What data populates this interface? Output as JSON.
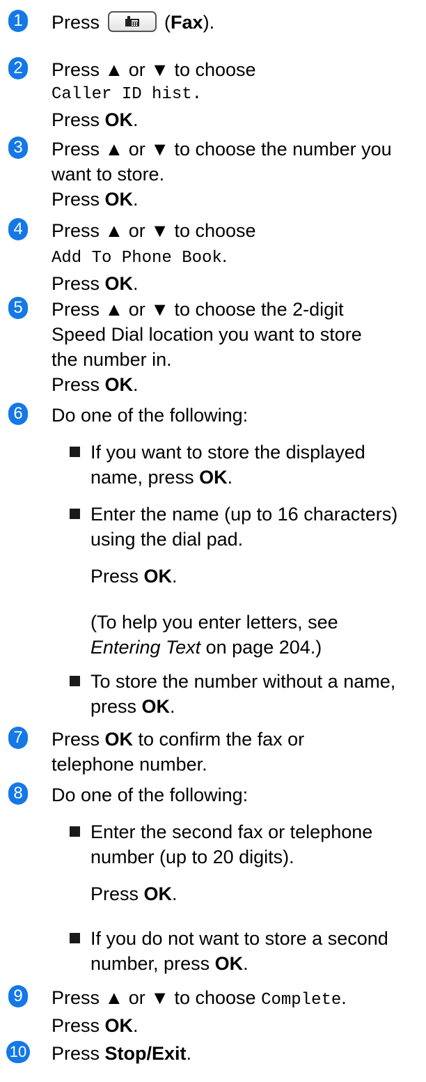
{
  "steps": [
    {
      "n": "1",
      "press": "Press",
      "fax_open": " (",
      "fax": "Fax",
      "fax_close": ")."
    },
    {
      "n": "2",
      "l1": "Press ▲ or ▼ to choose",
      "menu": "Caller ID hist.",
      "press": "Press ",
      "ok": "OK",
      "dot": "."
    },
    {
      "n": "3",
      "l1": "Press ▲ or ▼ to choose the number you",
      "l2": "want to store.",
      "press": "Press ",
      "ok": "OK",
      "dot": "."
    },
    {
      "n": "4",
      "l1": "Press ▲ or ▼ to choose",
      "menu": "Add To Phone Book",
      "menu_dot": ".",
      "press": "Press ",
      "ok": "OK",
      "dot": "."
    },
    {
      "n": "5",
      "l1": "Press ▲ or ▼ to choose the 2-digit",
      "l2": "Speed Dial location you want to store",
      "l3": "the number in.",
      "press": "Press ",
      "ok": "OK",
      "dot": "."
    },
    {
      "n": "6",
      "l1": "Do one of the following:",
      "b1_l1": "If you want to store the displayed",
      "b1_l2": "name, press ",
      "b1_ok": "OK",
      "b1_dot": ".",
      "b2_l1": "Enter the name (up to 16 characters)",
      "b2_l2": "using the dial pad.",
      "b2_press": "Press ",
      "b2_ok": "OK",
      "b2_dot": ".",
      "b2_help": "(To help you enter letters, see",
      "b2_link": "Entering Text",
      "b2_page": " on page 204.)",
      "b3_l1": "To store the number without a name,",
      "b3_l2": "press ",
      "b3_ok": "OK",
      "b3_dot": "."
    },
    {
      "n": "7",
      "press": "Press ",
      "ok": "OK",
      "l1_rest": " to confirm the fax or",
      "l2": "telephone number."
    },
    {
      "n": "8",
      "l1": "Do one of the following:",
      "b1_l1": "Enter the second fax or telephone",
      "b1_l2": "number (up to 20 digits).",
      "b1_press": "Press ",
      "b1_ok": "OK",
      "b1_dot": ".",
      "b2_l1": "If you do not want to store a second",
      "b2_l2": "number, press ",
      "b2_ok": "OK",
      "b2_dot": "."
    },
    {
      "n": "9",
      "l1": "Press ▲ or ▼ to choose ",
      "menu": "Complete",
      "menu_dot": ".",
      "press": "Press ",
      "ok": "OK",
      "dot": "."
    },
    {
      "n": "10",
      "press": "Press ",
      "stop": "Stop/Exit",
      "dot": "."
    }
  ],
  "icons": {
    "fax_key": "fax-key-icon",
    "bullet": "square-bullet-icon",
    "step_number": "step-number-badge"
  },
  "colors": {
    "step_badge": "#1478e6",
    "text": "#000000",
    "bullet": "#1a1a1a"
  }
}
